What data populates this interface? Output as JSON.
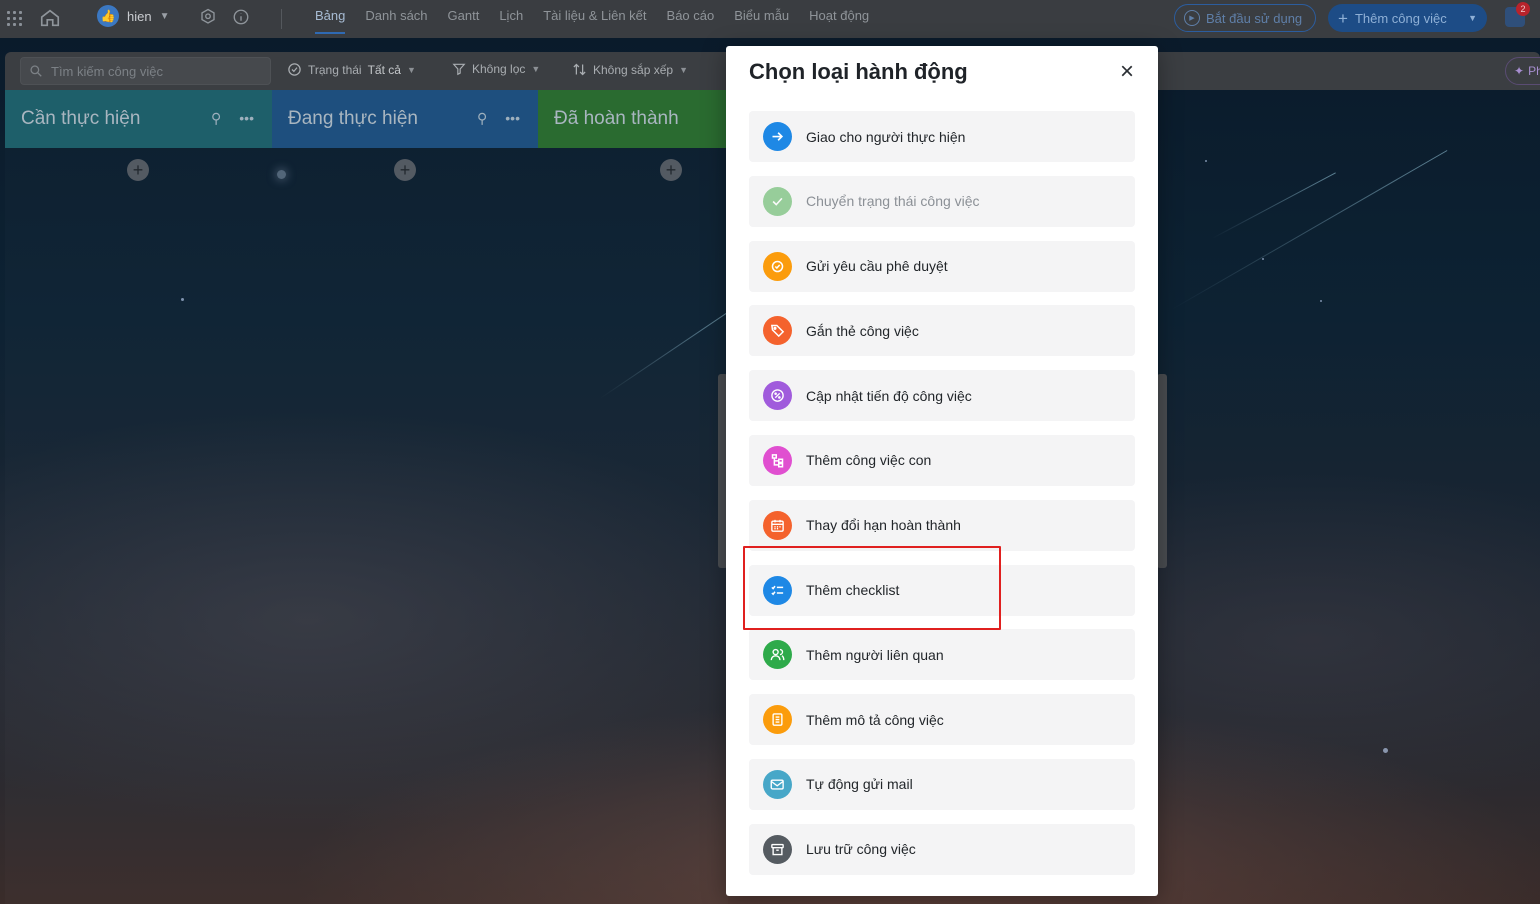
{
  "topbar": {
    "user_name": "hien",
    "tabs": [
      {
        "label": "Bảng",
        "active": true
      },
      {
        "label": "Danh sách",
        "active": false
      },
      {
        "label": "Gantt",
        "active": false
      },
      {
        "label": "Lịch",
        "active": false
      },
      {
        "label": "Tài liệu & Liên kết",
        "active": false
      },
      {
        "label": "Báo cáo",
        "active": false
      },
      {
        "label": "Biểu mẫu",
        "active": false
      },
      {
        "label": "Hoạt động",
        "active": false
      }
    ],
    "start_label": "Bắt đầu sử dụng",
    "add_task_label": "Thêm công việc",
    "notification_count": "2"
  },
  "filterbar": {
    "search_placeholder": "Tìm kiếm công việc",
    "status_label": "Trạng thái",
    "status_value": "Tất cả",
    "filter_label": "Không lọc",
    "sort_label": "Không sắp xếp",
    "right_chip": "Ph"
  },
  "columns": [
    {
      "title": "Cần thực hiện",
      "color": "#1e5f6a"
    },
    {
      "title": "Đang thực hiện",
      "color": "#1e4f7e"
    },
    {
      "title": "Đã hoàn thành",
      "color": "#2a6b30"
    }
  ],
  "modal": {
    "title": "Chọn loại hành động",
    "options": [
      {
        "label": "Giao cho người thực hiện",
        "icon": "arrow-right-icon",
        "color": "#1e88e5",
        "disabled": false
      },
      {
        "label": "Chuyển trạng thái công việc",
        "icon": "check-icon",
        "color": "#4caf50",
        "disabled": true
      },
      {
        "label": "Gửi yêu cầu phê duyệt",
        "icon": "approval-icon",
        "color": "#fb9c0c",
        "disabled": false
      },
      {
        "label": "Gắn thẻ công việc",
        "icon": "tag-icon",
        "color": "#f4622d",
        "disabled": false
      },
      {
        "label": "Cập nhật tiến độ công việc",
        "icon": "percent-icon",
        "color": "#a05bdc",
        "disabled": false
      },
      {
        "label": "Thêm công việc con",
        "icon": "subtask-icon",
        "color": "#e04fd0",
        "disabled": false
      },
      {
        "label": "Thay đổi hạn hoàn thành",
        "icon": "calendar-icon",
        "color": "#f4622d",
        "disabled": false
      },
      {
        "label": "Thêm checklist",
        "icon": "checklist-icon",
        "color": "#1e88e5",
        "disabled": false
      },
      {
        "label": "Thêm người liên quan",
        "icon": "users-icon",
        "color": "#2eaa4a",
        "disabled": false
      },
      {
        "label": "Thêm mô tả công việc",
        "icon": "document-icon",
        "color": "#fb9c0c",
        "disabled": false
      },
      {
        "label": "Tự động gửi mail",
        "icon": "mail-icon",
        "color": "#47a7c8",
        "disabled": false
      },
      {
        "label": "Lưu trữ công việc",
        "icon": "archive-icon",
        "color": "#555b61",
        "disabled": false
      }
    ]
  },
  "highlight_color": "#e0201f"
}
